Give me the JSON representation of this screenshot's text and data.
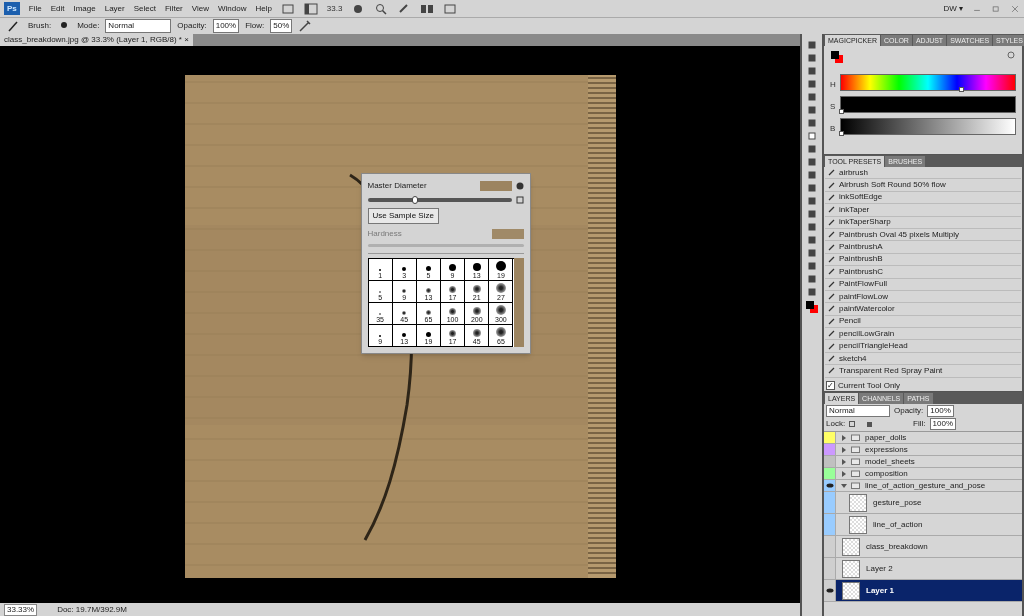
{
  "menu": {
    "app_badge": "Ps",
    "items": [
      "File",
      "Edit",
      "Image",
      "Layer",
      "Select",
      "Filter",
      "View",
      "Window",
      "Help"
    ],
    "zoom": "33.3",
    "workspace": "DW",
    "workspace_caret": "▾"
  },
  "options_bar": {
    "brush_label": "Brush:",
    "mode_label": "Mode:",
    "mode": "Normal",
    "opacity_label": "Opacity:",
    "opacity": "100%",
    "flow_label": "Flow:",
    "flow": "50%"
  },
  "document": {
    "tab": "class_breakdown.jpg @ 33.3% (Layer 1, RGB/8) *",
    "tab_close": "×",
    "status_zoom": "33.33%",
    "status_doc": "Doc: 19.7M/392.9M"
  },
  "brush_popup": {
    "master_diameter_label": "Master Diameter",
    "diameter": {
      "level": 0.33
    },
    "sample_button": "Use Sample Size",
    "hardness_label": "Hardness",
    "hardness_disabled": true,
    "brushes": [
      {
        "size": "1",
        "kind": "hard"
      },
      {
        "size": "3",
        "kind": "hard"
      },
      {
        "size": "5",
        "kind": "hard"
      },
      {
        "size": "9",
        "kind": "hard"
      },
      {
        "size": "13",
        "kind": "hard"
      },
      {
        "size": "19",
        "kind": "hard"
      },
      {
        "size": "5",
        "kind": "soft"
      },
      {
        "size": "9",
        "kind": "soft"
      },
      {
        "size": "13",
        "kind": "soft"
      },
      {
        "size": "17",
        "kind": "soft"
      },
      {
        "size": "21",
        "kind": "soft"
      },
      {
        "size": "27",
        "kind": "soft"
      },
      {
        "size": "35",
        "kind": "soft"
      },
      {
        "size": "45",
        "kind": "soft"
      },
      {
        "size": "65",
        "kind": "soft"
      },
      {
        "size": "100",
        "kind": "soft"
      },
      {
        "size": "200",
        "kind": "soft"
      },
      {
        "size": "300",
        "kind": "soft"
      },
      {
        "size": "9",
        "kind": "hard"
      },
      {
        "size": "13",
        "kind": "hard"
      },
      {
        "size": "19",
        "kind": "hard"
      },
      {
        "size": "17",
        "kind": "soft"
      },
      {
        "size": "45",
        "kind": "soft"
      },
      {
        "size": "65",
        "kind": "soft"
      }
    ]
  },
  "color_panel": {
    "tabs": [
      {
        "label": "MAGICPICKER",
        "selected": true
      },
      {
        "label": "COLOR",
        "selected": false
      },
      {
        "label": "ADJUST",
        "selected": false
      },
      {
        "label": "SWATCHES",
        "selected": false
      },
      {
        "label": "STYLES",
        "selected": false
      }
    ],
    "sliders": [
      {
        "label": "H",
        "kind": "hue",
        "level": 0.69
      },
      {
        "label": "S",
        "kind": "dark",
        "level": 0
      },
      {
        "label": "B",
        "kind": "gray",
        "level": 0
      }
    ]
  },
  "presets_panel": {
    "tabs": [
      {
        "label": "TOOL PRESETS",
        "selected": true
      },
      {
        "label": "BRUSHES",
        "selected": false
      }
    ],
    "items": [
      "airbrush",
      "Airbrush Soft Round 50% flow",
      "inkSoftEdge",
      "inkTaper",
      "inkTaperSharp",
      "Paintbrush Oval 45 pixels Multiply",
      "PaintbrushA",
      "PaintbrushB",
      "PaintbrushC",
      "PaintFlowFull",
      "paintFlowLow",
      "paintWatercolor",
      "Pencil",
      "pencilLowGrain",
      "pencilTriangleHead",
      "sketch4",
      "Transparent Red Spray Paint"
    ],
    "current_tool_only": {
      "label": "Current Tool Only",
      "checked": true,
      "check_mark": "✓"
    }
  },
  "layers_panel": {
    "tabs": [
      {
        "label": "LAYERS",
        "selected": true
      },
      {
        "label": "CHANNELS",
        "selected": false
      },
      {
        "label": "PATHS",
        "selected": false
      }
    ],
    "blend": "Normal",
    "opacity_label": "Opacity:",
    "opacity": "100%",
    "lock_label": "Lock:",
    "fill_label": "Fill:",
    "fill": "100%",
    "layers": [
      {
        "name": "paper_dolls",
        "kind": "group",
        "color": "#ffff66",
        "visible": false,
        "expanded": false,
        "selected": false
      },
      {
        "name": "expressions",
        "kind": "group",
        "color": "#cc99ff",
        "visible": false,
        "expanded": false,
        "selected": false
      },
      {
        "name": "model_sheets",
        "kind": "group",
        "color": "#c0c0c0",
        "visible": false,
        "expanded": false,
        "selected": false
      },
      {
        "name": "composition",
        "kind": "group",
        "color": "#99ff99",
        "visible": false,
        "expanded": false,
        "selected": false
      },
      {
        "name": "line_of_action_gesture_and_pose",
        "kind": "group",
        "color": "#99ccff",
        "visible": true,
        "expanded": true,
        "selected": false,
        "children": [
          {
            "name": "gesture_pose",
            "kind": "layer",
            "color": "#99ccff",
            "visible": false,
            "selected": false
          },
          {
            "name": "line_of_action",
            "kind": "layer",
            "color": "#99ccff",
            "visible": false,
            "selected": false
          }
        ]
      },
      {
        "name": "class_breakdown",
        "kind": "layer",
        "visible": false,
        "selected": false
      },
      {
        "name": "Layer 2",
        "kind": "layer",
        "visible": false,
        "selected": false
      },
      {
        "name": "Layer 1",
        "kind": "layer",
        "visible": true,
        "selected": true
      }
    ]
  }
}
